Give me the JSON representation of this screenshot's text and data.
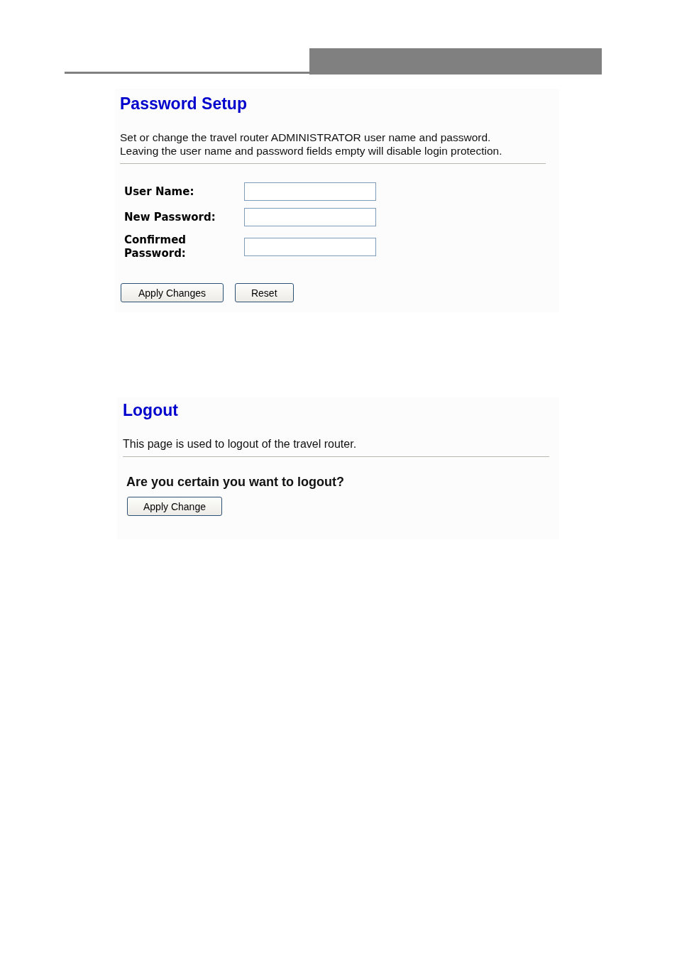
{
  "password_setup": {
    "title": "Password Setup",
    "description": [
      "Set or change the travel router ADMINISTRATOR user name and password.",
      "Leaving the user name and password fields empty will disable login protection."
    ],
    "fields": [
      {
        "label": "User Name:"
      },
      {
        "label": "New Password:"
      },
      {
        "label": "Confirmed Password:"
      }
    ],
    "buttons": [
      "Apply Changes",
      "Reset"
    ]
  },
  "logout": {
    "title": "Logout",
    "description": "This page is used to logout of the travel router.",
    "question": "Are you certain you want to logout?",
    "buttons": [
      "Apply Change"
    ]
  }
}
